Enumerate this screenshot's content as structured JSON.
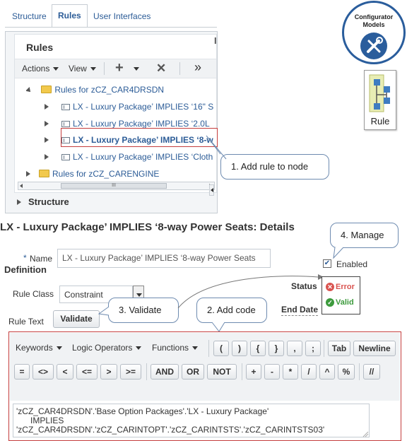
{
  "tabs": [
    {
      "label": "Structure"
    },
    {
      "label": "Rules"
    },
    {
      "label": "User Interfaces"
    }
  ],
  "rules_panel": {
    "title": "Rules",
    "toolbar": {
      "actions": "Actions",
      "view": "View",
      "add": "+",
      "delete": "✕",
      "more": "»"
    },
    "tree": [
      {
        "label": "Rules for zCZ_CAR4DRSDN",
        "type": "folder",
        "expanded": true
      },
      {
        "label": "LX - Luxury Package’ IMPLIES ‘16\" S",
        "type": "rule"
      },
      {
        "label": "LX - Luxury Package’ IMPLIES ‘2.0L",
        "type": "rule"
      },
      {
        "label": "LX - Luxury Package’ IMPLIES ‘8-w",
        "type": "rule",
        "selected": true
      },
      {
        "label": "LX - Luxury Package’ IMPLIES ‘Cloth",
        "type": "rule"
      },
      {
        "label": "Rules for zCZ_CARENGINE",
        "type": "folder",
        "expanded": false
      }
    ],
    "scroll_mark": "III",
    "structure_label": "Structure"
  },
  "side_panel_mark": "I",
  "configurator_models": {
    "line1": "Configurator",
    "line2": "Models"
  },
  "rule_card": {
    "label": "Rule"
  },
  "callouts": {
    "add_rule": "1. Add rule to node",
    "add_code": "2. Add code",
    "validate": "3. Validate",
    "manage": "4. Manage"
  },
  "details": {
    "title": "LX - Luxury Package’ IMPLIES ‘8-way Power Seats: Details",
    "required_mark": "*",
    "name_label": "Name",
    "name_value": "LX - Luxury Package’ IMPLIES ‘8-way Power Seats",
    "definition_label": "Definition",
    "rule_class_label": "Rule Class",
    "rule_class_value": "Constraint",
    "rule_text_label": "Rule Text",
    "validate_button": "Validate",
    "enabled_label": "Enabled",
    "enabled_checked": true,
    "status_label": "Status",
    "status_error": "Error",
    "status_valid": "Valid",
    "end_date_label": "End Date"
  },
  "code_toolbar": {
    "keywords": "Keywords",
    "logic_operators": "Logic Operators",
    "functions": "Functions",
    "row1_symbols": [
      "(",
      ")",
      "{",
      "}",
      ",",
      ";"
    ],
    "tab": "Tab",
    "newline": "Newline",
    "row2_symbols": [
      "=",
      "<>",
      "<",
      "<=",
      ">",
      ">="
    ],
    "and": "AND",
    "or": "OR",
    "not": "NOT",
    "math_symbols": [
      "+",
      "-",
      "*",
      "/",
      "^",
      "%"
    ],
    "comment": "//"
  },
  "code_text": "'zCZ_CAR4DRSDN'.'Base Option Packages'.'LX - Luxury Package'\n      IMPLIES\n'zCZ_CAR4DRSDN'.'zCZ_CARINTOPT'.'zCZ_CARINTSTS'.'zCZ_CARINTSTS03'",
  "colors": {
    "link": "#2c5c97",
    "highlight_border": "#c43d3d",
    "error": "#d9534f",
    "valid": "#3c9a3c",
    "brand": "#2a5d9c"
  }
}
